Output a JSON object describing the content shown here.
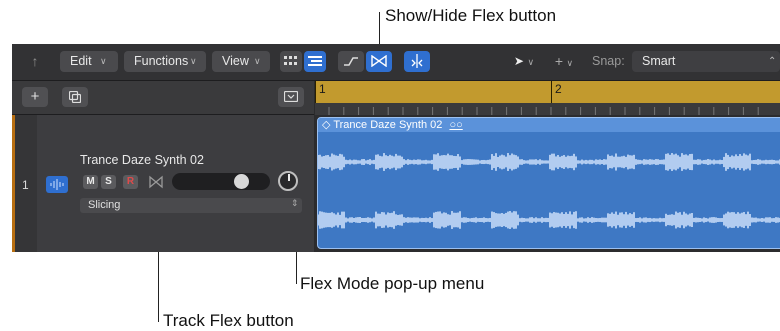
{
  "callouts": {
    "flex_button": "Show/Hide Flex button",
    "flex_mode_menu": "Flex Mode pop-up menu",
    "track_flex": "Track Flex button"
  },
  "toolbar": {
    "edit": "Edit",
    "functions": "Functions",
    "view": "View",
    "snap_label": "Snap:",
    "snap_value": "Smart"
  },
  "ruler": {
    "bar1": "1",
    "bar2": "2"
  },
  "track": {
    "number": "1",
    "name": "Trance Daze Synth 02",
    "mute": "M",
    "solo": "S",
    "record": "R",
    "flex_mode": "Slicing",
    "volume_fraction": 0.75
  },
  "region": {
    "name": "Trance Daze Synth 02"
  },
  "colors": {
    "accent": "#2f6fd0",
    "region": "#3e78c4",
    "ruler": "#c29a2e",
    "track_strip": "#b86f12"
  }
}
